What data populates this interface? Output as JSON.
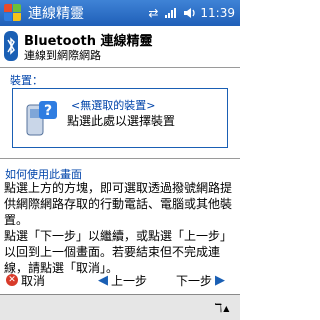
{
  "titlebar": {
    "title": "連線精靈",
    "time": "11:39",
    "icons": [
      "windows-start-icon",
      "sync-arrows-icon",
      "signal-icon",
      "volume-icon"
    ]
  },
  "header": {
    "title": "Bluetooth 連線精靈",
    "subtitle": "連線到網際網路"
  },
  "device": {
    "label": "裝置：",
    "none_text": "<無選取的裝置>",
    "hint": "點選此處以選擇裝置"
  },
  "help": {
    "title": "如何使用此畫面",
    "paragraph1": "點選上方的方塊，即可選取透過撥號網路提供網際網路存取的行動電話、電腦或其他裝置。",
    "paragraph2": "點選「下一步」以繼續，或點選「上一步」以回到上一個畫面。若要結束但不完成連線，請點選「取消」。"
  },
  "buttons": {
    "cancel": "取消",
    "back": "上一步",
    "next": "下一步"
  },
  "colors": {
    "titlebar": "#1f5fb8",
    "accent": "#1a5fb4",
    "label": "#0044aa"
  }
}
